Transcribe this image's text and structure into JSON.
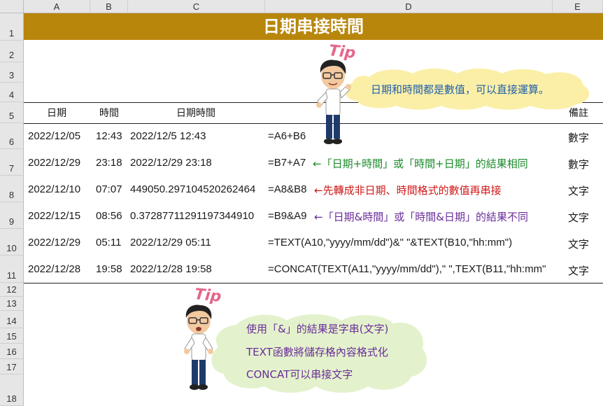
{
  "columns": [
    "A",
    "B",
    "C",
    "D",
    "E"
  ],
  "rows": [
    "1",
    "2",
    "3",
    "4",
    "5",
    "6",
    "7",
    "8",
    "9",
    "10",
    "11",
    "12",
    "13",
    "14",
    "15",
    "16",
    "17",
    "18"
  ],
  "title": "日期串接時間",
  "headers": {
    "date": "日期",
    "time": "時間",
    "datetime": "日期時間",
    "remark": "備註"
  },
  "data_rows": [
    {
      "date": "2022/12/05",
      "time": "12:43",
      "result": "2022/12/5 12:43",
      "formula": "=A6+B6",
      "remark": "數字"
    },
    {
      "date": "2022/12/29",
      "time": "23:18",
      "result": "2022/12/29 23:18",
      "formula": "=B7+A7",
      "remark": "數字"
    },
    {
      "date": "2022/12/10",
      "time": "07:07",
      "result": "449050.297104520262464",
      "formula": "=A8&B8",
      "remark": "文字"
    },
    {
      "date": "2022/12/15",
      "time": "08:56",
      "result": "0.37287711291197344910",
      "formula": "=B9&A9",
      "remark": "文字"
    },
    {
      "date": "2022/12/29",
      "time": "05:11",
      "result": "2022/12/29 05:11",
      "formula": "=TEXT(A10,\"yyyy/mm/dd\")&\" \"&TEXT(B10,\"hh:mm\")",
      "remark": "文字"
    },
    {
      "date": "2022/12/28",
      "time": "19:58",
      "result": "2022/12/28 19:58",
      "formula": "=CONCAT(TEXT(A11,\"yyyy/mm/dd\"),\" \",TEXT(B11,\"hh:mm\"",
      "remark": "文字"
    }
  ],
  "notes": {
    "row7": "←「日期+時間」或「時間+日期」的結果相同",
    "row8": "←先轉成非日期、時間格式的數值再串接",
    "row9": "←「日期&時間」或「時間&日期」的結果不同"
  },
  "note_colors": {
    "row7": "#1a8a2a",
    "row8": "#d01818",
    "row9": "#6a2d9a"
  },
  "callout1": {
    "tip": "Tip",
    "text": "日期和時間都是數值，可以直接運算。"
  },
  "callout2": {
    "tip": "Tip",
    "lines": [
      "使用「&」的結果是字串(文字)",
      "TEXT函數將儲存格內容格式化",
      "CONCAT可以串接文字"
    ]
  },
  "colors": {
    "banner": "#b8860b",
    "cloud1": "#fbefa8",
    "cloud2": "#e3f2cc",
    "text_blue": "#1f5fa8",
    "text_purple": "#6a2d9a"
  }
}
